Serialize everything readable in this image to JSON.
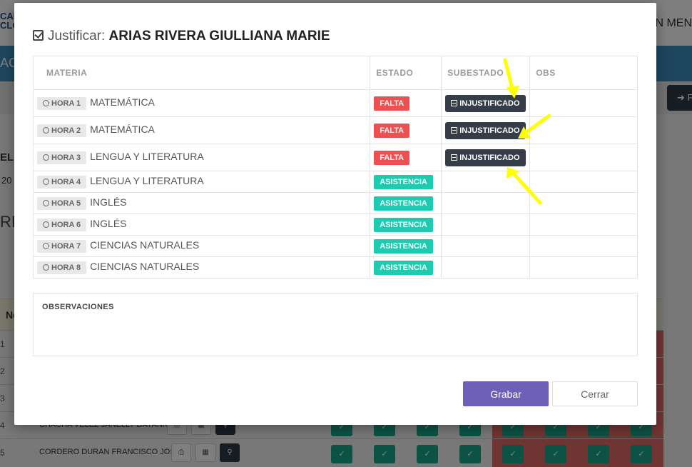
{
  "background": {
    "logo_line1": "CAD",
    "logo_line2": "CLO",
    "menu_text": "N MEN",
    "bluebar_text": "ACA",
    "dark_button_text": "➜ F",
    "text1": "EL",
    "text2": "20",
    "text3": "RI",
    "table_head": "No",
    "rows": [
      {
        "num": "1",
        "name": ""
      },
      {
        "num": "2",
        "name": ""
      },
      {
        "num": "3",
        "name": ""
      },
      {
        "num": "4",
        "name": "CHACHA VELEZ JANELLY DAYANNA"
      },
      {
        "num": "5",
        "name": "CORDERO DURAN FRANCISCO JOSE"
      }
    ]
  },
  "modal": {
    "title_prefix": "Justificar:",
    "student_name": "ARIAS RIVERA GIULLIANA MARIE",
    "columns": {
      "materia": "MATERIA",
      "estado": "ESTADO",
      "subestado": "SUBESTADO",
      "obs": "OBS"
    },
    "rows": [
      {
        "hora": "HORA 1",
        "materia": "MATEMÁTICA",
        "estado": "FALTA",
        "subestado": "INJUSTIFICADO"
      },
      {
        "hora": "HORA 2",
        "materia": "MATEMÁTICA",
        "estado": "FALTA",
        "subestado": "INJUSTIFICADO"
      },
      {
        "hora": "HORA 3",
        "materia": "LENGUA Y LITERATURA",
        "estado": "FALTA",
        "subestado": "INJUSTIFICADO"
      },
      {
        "hora": "HORA 4",
        "materia": "LENGUA Y LITERATURA",
        "estado": "ASISTENCIA",
        "subestado": ""
      },
      {
        "hora": "HORA 5",
        "materia": "INGLÉS",
        "estado": "ASISTENCIA",
        "subestado": ""
      },
      {
        "hora": "HORA 6",
        "materia": "INGLÉS",
        "estado": "ASISTENCIA",
        "subestado": ""
      },
      {
        "hora": "HORA 7",
        "materia": "CIENCIAS NATURALES",
        "estado": "ASISTENCIA",
        "subestado": ""
      },
      {
        "hora": "HORA 8",
        "materia": "CIENCIAS NATURALES",
        "estado": "ASISTENCIA",
        "subestado": ""
      }
    ],
    "observaciones_label": "OBSERVACIONES",
    "save_label": "Grabar",
    "close_label": "Cerrar"
  },
  "colors": {
    "falta": "#ec5050",
    "asistencia": "#1fcbb0",
    "subestado_button": "#343d48",
    "primary_button": "#6e5fb8",
    "annotation_arrow": "#ffff00"
  }
}
